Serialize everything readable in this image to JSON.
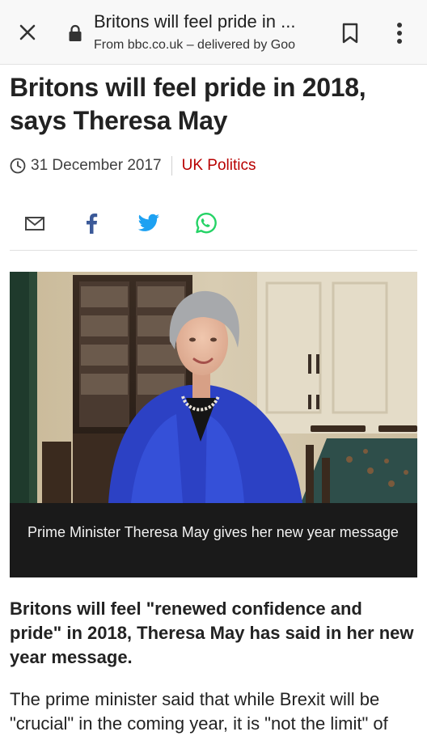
{
  "toolbar": {
    "title": "Britons will feel pride in ...",
    "subtitle": "From bbc.co.uk – delivered by Goo"
  },
  "article": {
    "headline": "Britons will feel pride in 2018, says Theresa May",
    "date": "31 December 2017",
    "section": "UK Politics",
    "caption": "Prime Minister Theresa May gives her new year message",
    "lede": "Britons will feel \"renewed confidence and pride\" in 2018, Theresa May has said in her new year message.",
    "body": "The prime minister said that while Brexit will be \"crucial\" in the coming year, it is \"not the limit\" of"
  },
  "colors": {
    "section_accent": "#b80000",
    "facebook": "#3b5998",
    "twitter": "#1da1f2",
    "whatsapp": "#25d366"
  },
  "icons": [
    "close-icon",
    "lock-icon",
    "bookmark-icon",
    "more-vert-icon",
    "clock-icon",
    "email-icon",
    "facebook-icon",
    "twitter-icon",
    "whatsapp-icon"
  ]
}
